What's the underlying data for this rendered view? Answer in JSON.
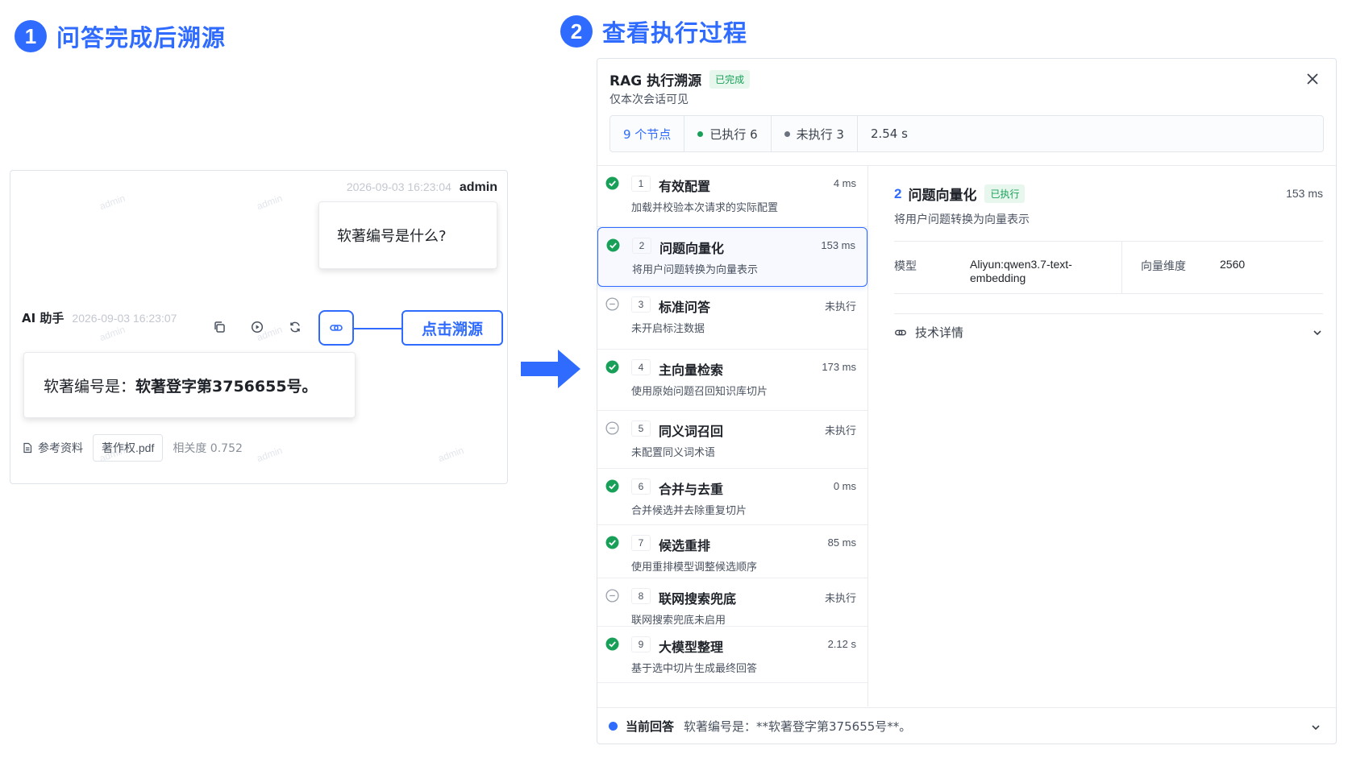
{
  "steps": {
    "one": {
      "num": "1",
      "title": "问答完成后溯源"
    },
    "two": {
      "num": "2",
      "title": "查看执行过程"
    }
  },
  "chat": {
    "watermark": "admin",
    "user_time": "2026-09-03 16:23:04",
    "user_name": "admin",
    "user_question": "软著编号是什么?",
    "ai_name": "AI 助手",
    "ai_time": "2026-09-03 16:23:07",
    "callout": "点击溯源",
    "ai_answer_prefix": "软著编号是：",
    "ai_answer_bold": "软著登字第3756655号。",
    "ref_label": "参考资料",
    "ref_file": "著作权.pdf",
    "ref_score": "相关度 0.752"
  },
  "drawer": {
    "title": "RAG 执行溯源",
    "status": "已完成",
    "subtitle": "仅本次会话可见",
    "stats": {
      "nodes": "9 个节点",
      "executed": "已执行 6",
      "not_executed": "未执行 3",
      "duration": "2.54 s"
    },
    "nodes": [
      {
        "num": "1",
        "name": "有效配置",
        "time": "4 ms",
        "desc": "加载并校验本次请求的实际配置",
        "status": "done"
      },
      {
        "num": "2",
        "name": "问题向量化",
        "time": "153 ms",
        "desc": "将用户问题转换为向量表示",
        "status": "done"
      },
      {
        "num": "3",
        "name": "标准问答",
        "time": "未执行",
        "desc": "未开启标注数据",
        "status": "skip"
      },
      {
        "num": "4",
        "name": "主向量检索",
        "time": "173 ms",
        "desc": "使用原始问题召回知识库切片",
        "status": "done"
      },
      {
        "num": "5",
        "name": "同义词召回",
        "time": "未执行",
        "desc": "未配置同义词术语",
        "status": "skip"
      },
      {
        "num": "6",
        "name": "合并与去重",
        "time": "0 ms",
        "desc": "合并候选并去除重复切片",
        "status": "done"
      },
      {
        "num": "7",
        "name": "候选重排",
        "time": "85 ms",
        "desc": "使用重排模型调整候选顺序",
        "status": "done"
      },
      {
        "num": "8",
        "name": "联网搜索兜底",
        "time": "未执行",
        "desc": "联网搜索兜底未启用",
        "status": "skip"
      },
      {
        "num": "9",
        "name": "大模型整理",
        "time": "2.12 s",
        "desc": "基于选中切片生成最终回答",
        "status": "done"
      }
    ],
    "detail": {
      "num": "2",
      "name": "问题向量化",
      "badge": "已执行",
      "time": "153 ms",
      "desc": "将用户问题转换为向量表示",
      "model_label": "模型",
      "model_value": "Aliyun:qwen3.7-text-embedding",
      "dim_label": "向量维度",
      "dim_value": "2560",
      "tech_label": "技术详情"
    },
    "footer": {
      "label": "当前回答",
      "text": "软著编号是：**软著登字第375655号**。"
    }
  },
  "colors": {
    "accent": "#2f6bff",
    "success": "#18a058",
    "muted": "#4a5260"
  }
}
